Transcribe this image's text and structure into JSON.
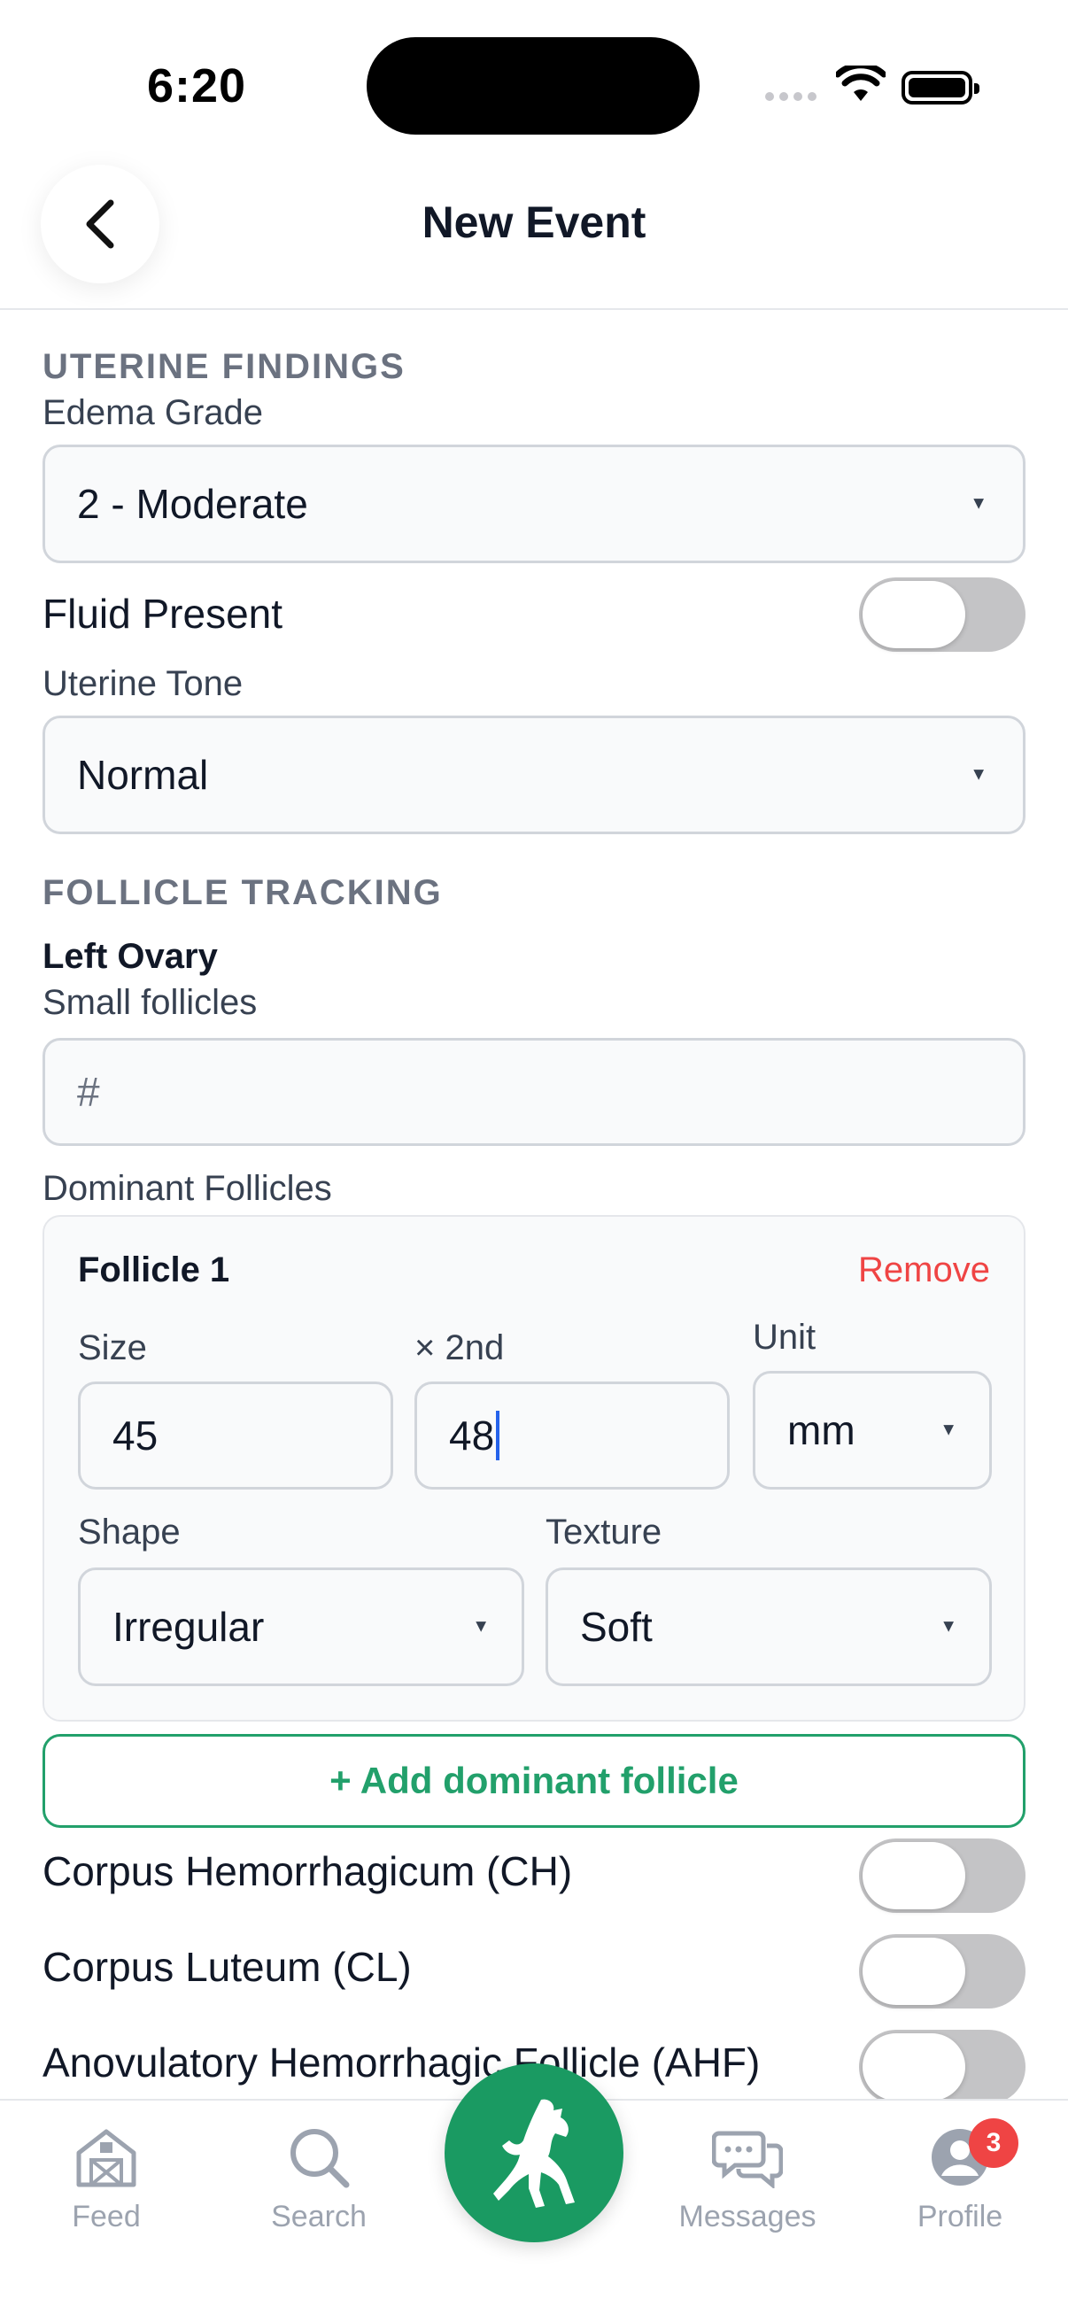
{
  "status_bar": {
    "time": "6:20"
  },
  "header": {
    "title": "New Event"
  },
  "uterine": {
    "section_title": "UTERINE FINDINGS",
    "edema_label": "Edema Grade",
    "edema_value": "2 - Moderate",
    "fluid_label": "Fluid Present",
    "fluid_on": false,
    "tone_label": "Uterine Tone",
    "tone_value": "Normal"
  },
  "follicle": {
    "section_title": "FOLLICLE TRACKING",
    "left_ovary_label": "Left Ovary",
    "small_label": "Small follicles",
    "small_placeholder": "#",
    "dominant_label": "Dominant Follicles",
    "card": {
      "title": "Follicle 1",
      "remove_label": "Remove",
      "size_label": "Size",
      "size_value": "45",
      "second_label": "× 2nd",
      "second_value": "48",
      "unit_label": "Unit",
      "unit_value": "mm",
      "shape_label": "Shape",
      "shape_value": "Irregular",
      "texture_label": "Texture",
      "texture_value": "Soft"
    },
    "add_label": "+ Add dominant follicle",
    "toggles": [
      {
        "label": "Corpus Hemorrhagicum (CH)",
        "on": false
      },
      {
        "label": "Corpus Luteum (CL)",
        "on": false
      },
      {
        "label": "Anovulatory Hemorrhagic Follicle (AHF)",
        "on": false
      }
    ]
  },
  "tab_bar": {
    "items": [
      {
        "label": "Feed",
        "icon": "barn-icon"
      },
      {
        "label": "Search",
        "icon": "search-icon"
      },
      {
        "label": "",
        "icon": "horse-icon"
      },
      {
        "label": "Messages",
        "icon": "chat-icon"
      },
      {
        "label": "Profile",
        "icon": "user-icon"
      }
    ],
    "profile_badge": "3"
  },
  "colors": {
    "accent": "#1a9a62",
    "danger": "#ef4444",
    "muted": "#9ca3af"
  }
}
